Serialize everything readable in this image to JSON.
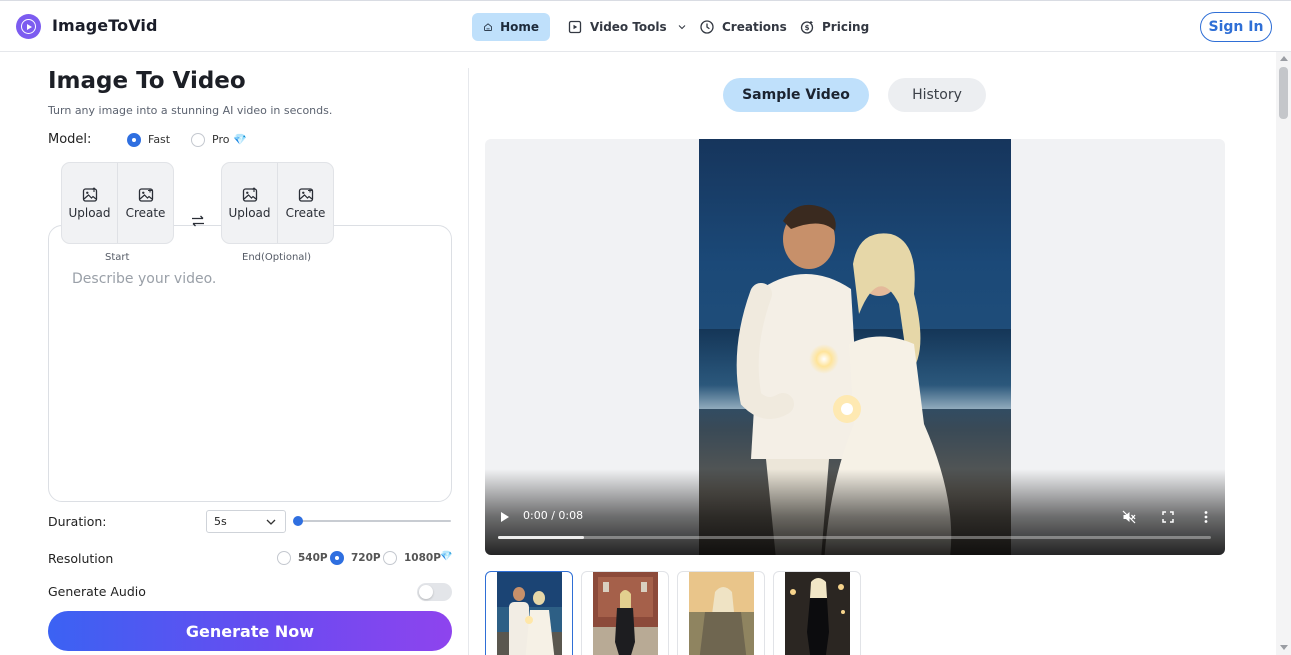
{
  "header": {
    "brand": "ImageToVid",
    "nav": [
      {
        "label": "Home",
        "icon": "home-icon",
        "active": true
      },
      {
        "label": "Video Tools",
        "icon": "video-tools-icon",
        "has_dropdown": true
      },
      {
        "label": "Creations",
        "icon": "clock-icon"
      },
      {
        "label": "Pricing",
        "icon": "coins-icon"
      }
    ],
    "signin_label": "Sign In"
  },
  "generator": {
    "title": "Image To Video",
    "subtitle": "Turn any image into a stunning AI video in seconds.",
    "model_label": "Model:",
    "model_options": [
      {
        "label": "Fast",
        "selected": true
      },
      {
        "label": "Pro",
        "badge": "💎",
        "selected": false
      }
    ],
    "start_card": {
      "upload_label": "Upload",
      "create_label": "Create",
      "caption": "Start"
    },
    "end_card": {
      "upload_label": "Upload",
      "create_label": "Create",
      "caption": "End(Optional)"
    },
    "prompt_placeholder": "Describe your video.",
    "duration_label": "Duration:",
    "duration_value": "5s",
    "duration_slider_value": 0,
    "resolution_label": "Resolution",
    "resolution_options": [
      {
        "label": "540P",
        "selected": false
      },
      {
        "label": "720P",
        "selected": true
      },
      {
        "label": "1080P",
        "badge": "💎",
        "selected": false
      }
    ],
    "audio_label": "Generate Audio",
    "audio_enabled": false,
    "generate_label": "Generate Now"
  },
  "preview": {
    "tabs": [
      {
        "label": "Sample Video",
        "active": true
      },
      {
        "label": "History",
        "active": false
      }
    ],
    "video": {
      "time": "0:00 / 0:08",
      "progress_fraction": 0.12,
      "muted": true
    },
    "thumbnails": [
      {
        "name": "couple-sparklers",
        "selected": true
      },
      {
        "name": "woman-campus-stairs",
        "selected": false
      },
      {
        "name": "woman-cloak-sunset",
        "selected": false
      },
      {
        "name": "woman-black-dress-street",
        "selected": false
      }
    ]
  },
  "colors": {
    "accent_blue": "#2f6fe0",
    "brand_purple": "#7c5cf0",
    "active_pill": "#bfe0fb",
    "generate_gradient_start": "#3b62f3",
    "generate_gradient_end": "#8e44ee"
  }
}
